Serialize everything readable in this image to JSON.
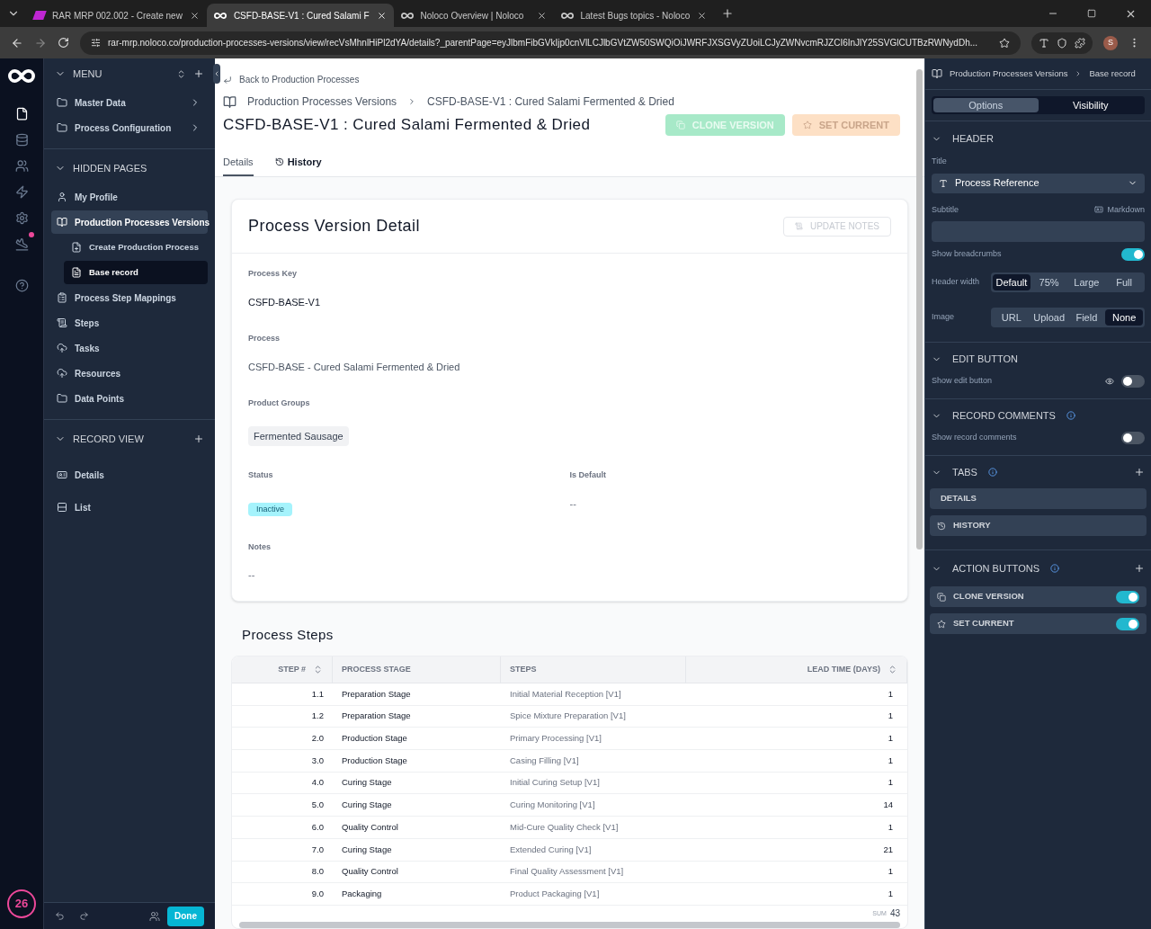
{
  "browser": {
    "tabs": [
      {
        "title": "RAR MRP 002.002 - Create new",
        "selected": false,
        "kind": "mrp"
      },
      {
        "title": "CSFD-BASE-V1 : Cured Salami F",
        "selected": true,
        "kind": "noloco"
      },
      {
        "title": "Noloco Overview | Noloco",
        "selected": false,
        "kind": "noloco"
      },
      {
        "title": "Latest Bugs topics - Noloco",
        "selected": false,
        "kind": "noloco"
      }
    ],
    "url": "rar-mrp.noloco.co/production-processes-versions/view/recVsMhnlHiPl2dYA/details?_parentPage=eyJlbmFibGVkIjp0cnVlLCJlbGVtZW50SWQiOiJWRFJXSGVyZUoiLCJyZWNvcmRJZCI6InJlY25SVGlCUTBzRWNydDh...",
    "avatar": "S"
  },
  "rail": {
    "items": [
      {
        "kind": "page",
        "selected": true
      },
      {
        "kind": "database",
        "selected": false
      },
      {
        "kind": "users",
        "selected": false
      },
      {
        "kind": "bolt",
        "selected": false
      },
      {
        "kind": "settings",
        "selected": false
      },
      {
        "kind": "plane",
        "selected": false,
        "dot": true
      },
      {
        "kind": "help",
        "selected": false
      }
    ],
    "badge": "26"
  },
  "sidebar": {
    "sections": [
      {
        "title": "MENU",
        "items": [
          {
            "label": "Master Data",
            "chevron": true,
            "selected": false
          },
          {
            "label": "Process Configuration",
            "chevron": true,
            "selected": false
          }
        ]
      },
      {
        "title": "HIDDEN PAGES",
        "items": [
          {
            "label": "My Profile",
            "selected": false
          },
          {
            "label": "Production Processes Versions",
            "selected": true,
            "children": [
              {
                "label": "Create Production Process",
                "selected": false
              },
              {
                "label": "Base record",
                "selected": true
              }
            ]
          },
          {
            "label": "Process Step Mappings",
            "selected": false
          },
          {
            "label": "Steps",
            "selected": false
          },
          {
            "label": "Tasks",
            "selected": false
          },
          {
            "label": "Resources",
            "selected": false
          },
          {
            "label": "Data Points",
            "selected": false
          }
        ]
      },
      {
        "title": "RECORD VIEW",
        "add": true,
        "items": [
          {
            "label": "Details",
            "selected": false
          },
          {
            "label": "List",
            "selected": false
          }
        ]
      }
    ],
    "done": "Done"
  },
  "main": {
    "back": "Back to Production Processes",
    "breadcrumbs": [
      "Production Processes Versions",
      "CSFD-BASE-V1 : Cured Salami Fermented & Dried"
    ],
    "title": "CSFD-BASE-V1 : Cured Salami Fermented & Dried",
    "actions": [
      {
        "label": "CLONE VERSION",
        "kind": "clone"
      },
      {
        "label": "SET CURRENT",
        "kind": "star"
      }
    ],
    "tabs": [
      {
        "label": "Details",
        "selected": true,
        "icon": false
      },
      {
        "label": "History",
        "selected": false,
        "icon": true
      }
    ],
    "card": {
      "title": "Process Version Detail",
      "button": "UPDATE NOTES",
      "fields": [
        {
          "label": "Process Key",
          "value": "CSFD-BASE-V1",
          "kind": "text"
        },
        {
          "label": "Process",
          "value": "CSFD-BASE - Cured Salami Fermented & Dried",
          "kind": "muted"
        },
        {
          "label": "Product Groups",
          "value": "Fermented Sausage",
          "kind": "chip"
        }
      ],
      "pairs": [
        {
          "label": "Status",
          "value": "Inactive",
          "kind": "badge"
        },
        {
          "label": "Is Default",
          "value": "--",
          "kind": "muted"
        }
      ],
      "notes": {
        "label": "Notes",
        "value": "--"
      }
    },
    "steps": {
      "title": "Process Steps",
      "columns": [
        {
          "label": "STEP #",
          "sortable": true
        },
        {
          "label": "PROCESS STAGE",
          "sortable": false
        },
        {
          "label": "STEPS",
          "sortable": false
        },
        {
          "label": "LEAD TIME (DAYS)",
          "sortable": true
        }
      ],
      "rows": [
        [
          "1.1",
          "Preparation Stage",
          "Initial Material Reception [V1]",
          "1"
        ],
        [
          "1.2",
          "Preparation Stage",
          "Spice Mixture Preparation [V1]",
          "1"
        ],
        [
          "2.0",
          "Production Stage",
          "Primary Processing [V1]",
          "1"
        ],
        [
          "3.0",
          "Production Stage",
          "Casing Filling [V1]",
          "1"
        ],
        [
          "4.0",
          "Curing Stage",
          "Initial Curing Setup [V1]",
          "1"
        ],
        [
          "5.0",
          "Curing Stage",
          "Curing Monitoring [V1]",
          "14"
        ],
        [
          "6.0",
          "Quality Control",
          "Mid-Cure Quality Check [V1]",
          "1"
        ],
        [
          "7.0",
          "Curing Stage",
          "Extended Curing [V1]",
          "21"
        ],
        [
          "8.0",
          "Quality Control",
          "Final Quality Assessment [V1]",
          "1"
        ],
        [
          "9.0",
          "Packaging",
          "Product Packaging [V1]",
          "1"
        ]
      ],
      "sum_label": "SUM",
      "sum": "43"
    }
  },
  "panel": {
    "breadcrumbs": [
      "Production Processes Versions",
      "Base record"
    ],
    "modes": [
      {
        "label": "Options",
        "selected": true
      },
      {
        "label": "Visibility",
        "selected": false
      }
    ],
    "header": {
      "title": "HEADER",
      "title_label": "Title",
      "title_value": "Process Reference",
      "subtitle_label": "Subtitle",
      "markdown": "Markdown",
      "breadcrumbs_label": "Show breadcrumbs",
      "breadcrumbs_on": true,
      "width_label": "Header width",
      "widths": [
        {
          "label": "Default",
          "selected": true
        },
        {
          "label": "75%",
          "selected": false
        },
        {
          "label": "Large",
          "selected": false
        },
        {
          "label": "Full",
          "selected": false
        }
      ],
      "image_label": "Image",
      "images": [
        {
          "label": "URL",
          "selected": false
        },
        {
          "label": "Upload",
          "selected": false
        },
        {
          "label": "Field",
          "selected": false
        },
        {
          "label": "None",
          "selected": true
        }
      ]
    },
    "edit": {
      "title": "EDIT BUTTON",
      "label": "Show edit button",
      "on": false
    },
    "comments": {
      "title": "RECORD COMMENTS",
      "label": "Show record comments",
      "on": false
    },
    "tabs": {
      "title": "TABS",
      "items": [
        {
          "label": "DETAILS",
          "icon": false
        },
        {
          "label": "HISTORY",
          "icon": true
        }
      ]
    },
    "actions": {
      "title": "ACTION BUTTONS",
      "items": [
        {
          "label": "CLONE VERSION",
          "kind": "clone",
          "on": true
        },
        {
          "label": "SET CURRENT",
          "kind": "star",
          "on": true
        }
      ]
    }
  }
}
